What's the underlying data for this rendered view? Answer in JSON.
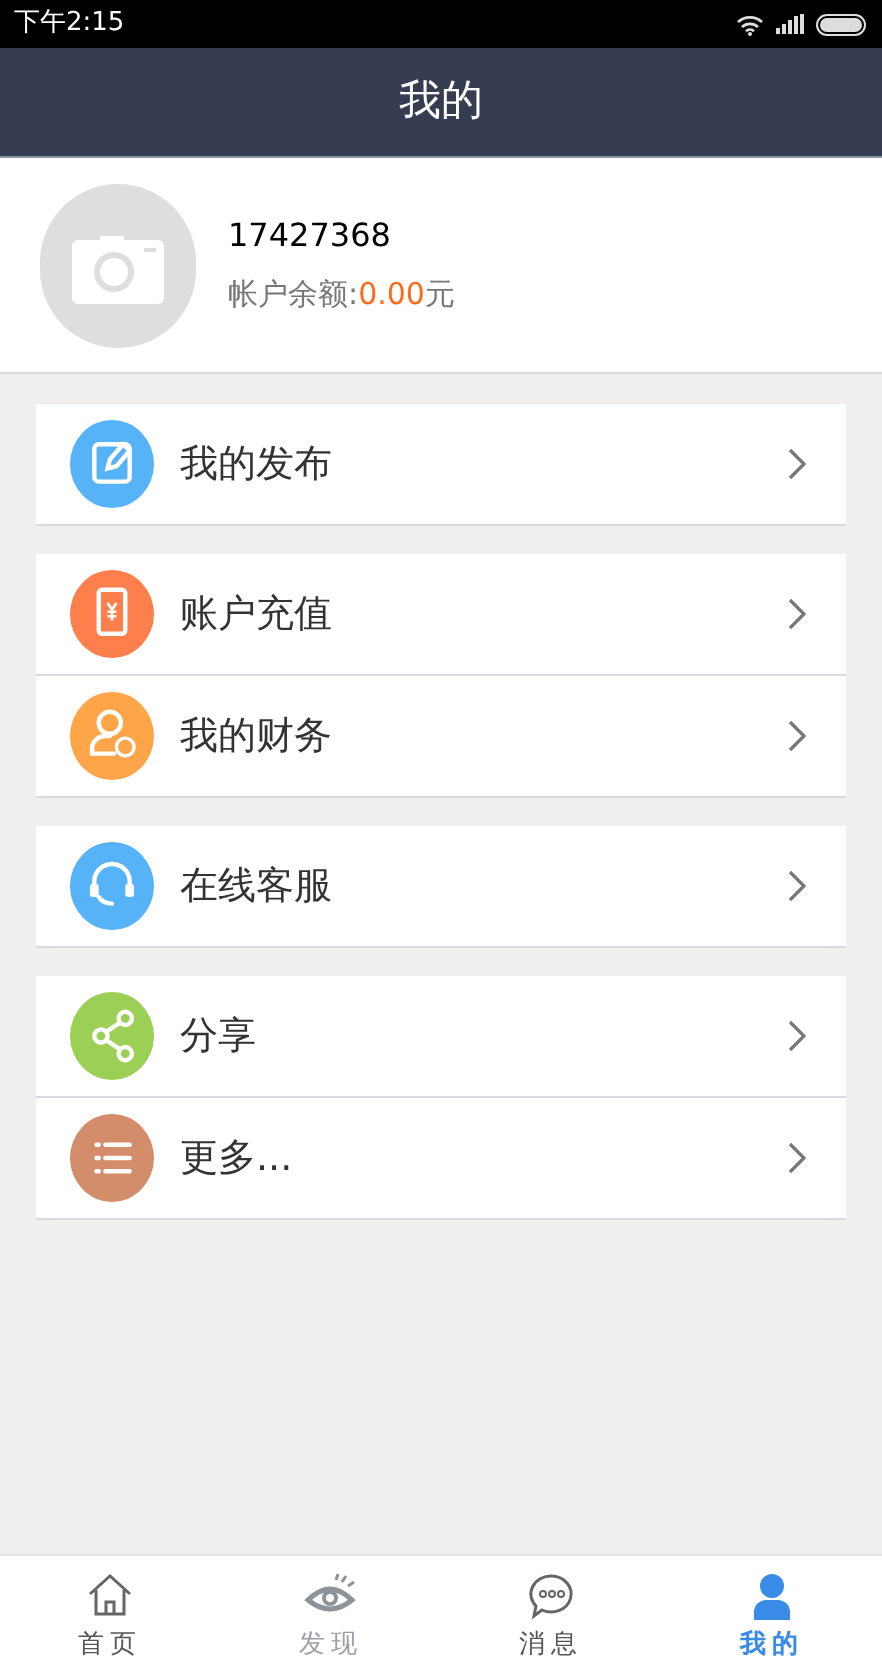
{
  "status_bar": {
    "time": "下午2:15"
  },
  "header": {
    "title": "我的"
  },
  "profile": {
    "user_id": "17427368",
    "balance_label": "帐户余额:",
    "balance_value": "0.00",
    "balance_unit": "元"
  },
  "menu_groups": [
    [
      {
        "label": "我的发布",
        "kind": "edit",
        "color": "#56b3f7"
      }
    ],
    [
      {
        "label": "账户充值",
        "kind": "phone",
        "color": "#fd7f4c"
      },
      {
        "label": "我的财务",
        "kind": "finance",
        "color": "#fea54a"
      }
    ],
    [
      {
        "label": "在线客服",
        "kind": "headset",
        "color": "#56b3f7"
      }
    ],
    [
      {
        "label": "分享",
        "kind": "share",
        "color": "#9ccf55"
      },
      {
        "label": "更多...",
        "kind": "list",
        "color": "#d48d6b"
      }
    ]
  ],
  "tabs": [
    {
      "label": "首页",
      "kind": "home",
      "selected": false
    },
    {
      "label": "发现",
      "kind": "eye",
      "selected": false
    },
    {
      "label": "消息",
      "kind": "chat",
      "selected": false
    },
    {
      "label": "我的",
      "kind": "person",
      "selected": true
    }
  ]
}
